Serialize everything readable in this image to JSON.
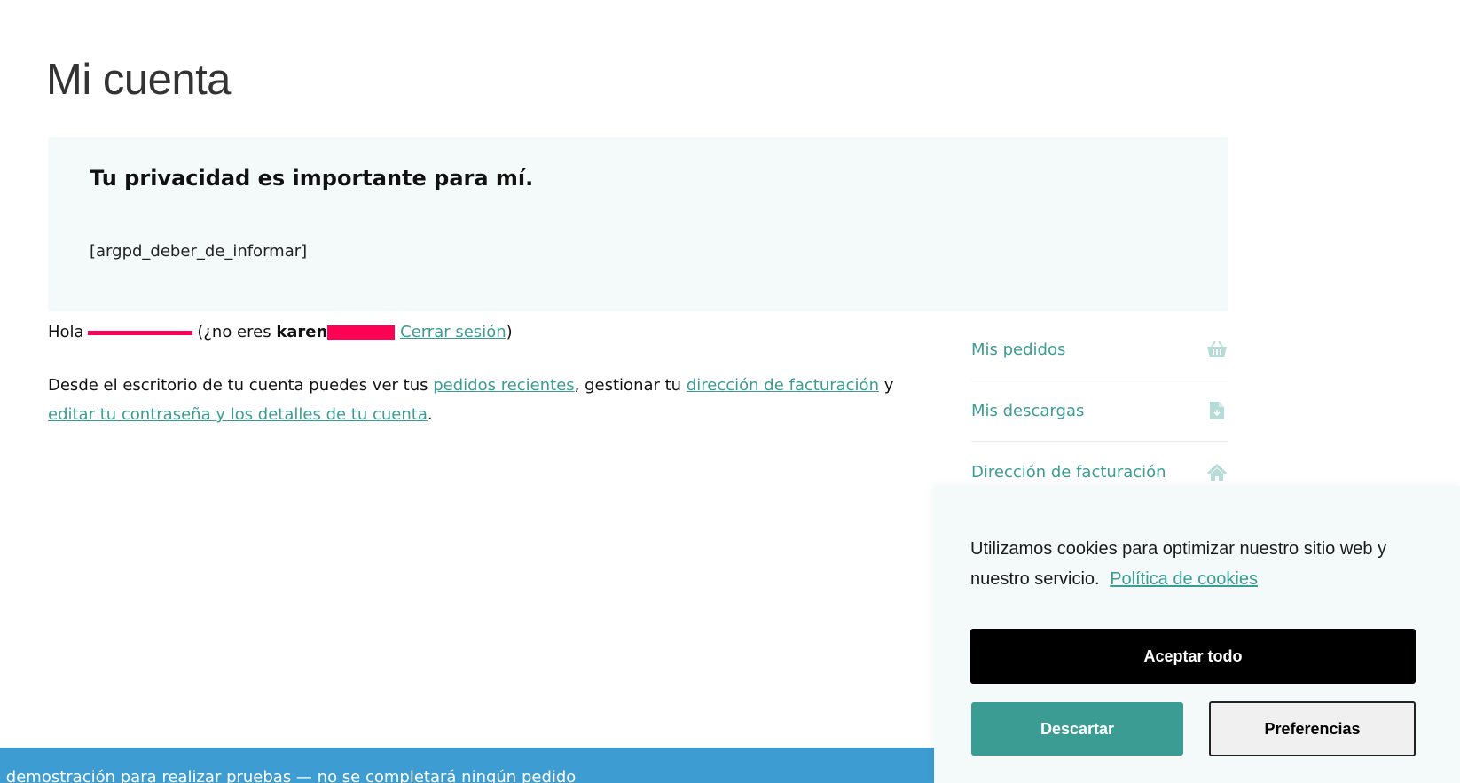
{
  "page": {
    "title": "Mi cuenta"
  },
  "privacy": {
    "heading": "Tu privacidad es importante para mí.",
    "shortcode": "[argpd_deber_de_informar]"
  },
  "greeting": {
    "hello": "Hola",
    "not_you_prefix": "(¿no eres",
    "username_visible": "karen",
    "logout_link": "Cerrar sesión",
    "close_paren": ")"
  },
  "dashboard": {
    "text_1": "Desde el escritorio de tu cuenta puedes ver tus",
    "link_orders": "pedidos recientes",
    "text_2": ", gestionar tu",
    "link_billing": "dirección de facturación",
    "text_3": "y",
    "link_account": "editar tu contraseña y los detalles de tu cuenta",
    "text_4": "."
  },
  "account_nav": {
    "items": [
      {
        "label": "Mis pedidos",
        "icon": "basket-icon"
      },
      {
        "label": "Mis descargas",
        "icon": "file-download-icon"
      },
      {
        "label": "Dirección de facturación",
        "icon": "home-icon"
      }
    ]
  },
  "store_notice": {
    "text": "e demostración para realizar pruebas — no se completará ningún pedido"
  },
  "cookie_banner": {
    "message": "Utilizamos cookies para optimizar nuestro sitio web y nuestro servicio.",
    "policy_link": "Política de cookies",
    "accept_label": "Aceptar todo",
    "dismiss_label": "Descartar",
    "preferences_label": "Preferencias"
  },
  "colors": {
    "accent": "#3b9c94",
    "notice_bar": "#3d9cd2",
    "redaction": "#ff0055",
    "panel_bg": "#f4faf9"
  }
}
